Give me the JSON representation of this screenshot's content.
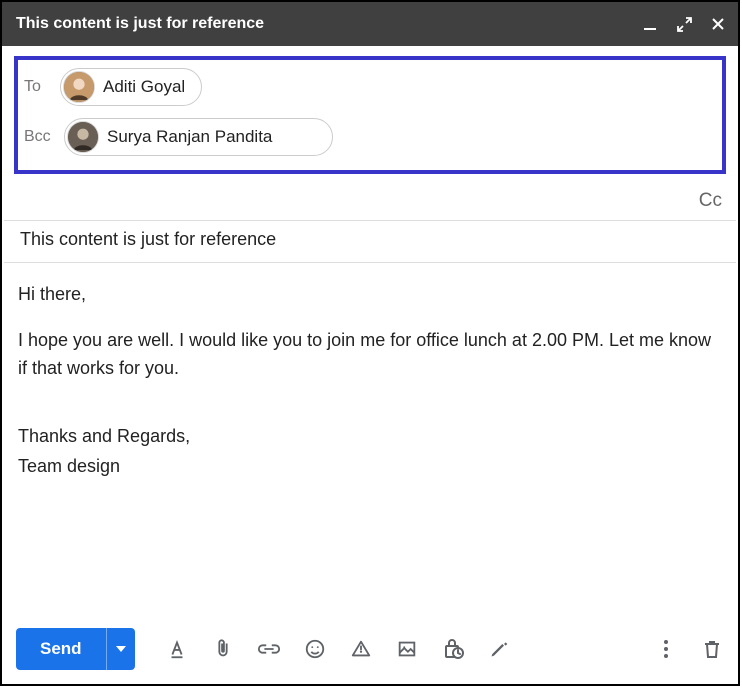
{
  "header": {
    "title": "This content is just for reference"
  },
  "recipients": {
    "to_label": "To",
    "bcc_label": "Bcc",
    "to_name": "Aditi Goyal",
    "bcc_name": "Surya Ranjan Pandita",
    "cc_link": "Cc"
  },
  "subject": "This content is just for reference",
  "body": {
    "greeting": "Hi there,",
    "para1": "I hope you are well. I would like you to join me for office lunch at 2.00 PM. Let me know if that works for you.",
    "sig1": "Thanks and Regards,",
    "sig2": "Team design"
  },
  "footer": {
    "send_label": "Send"
  }
}
